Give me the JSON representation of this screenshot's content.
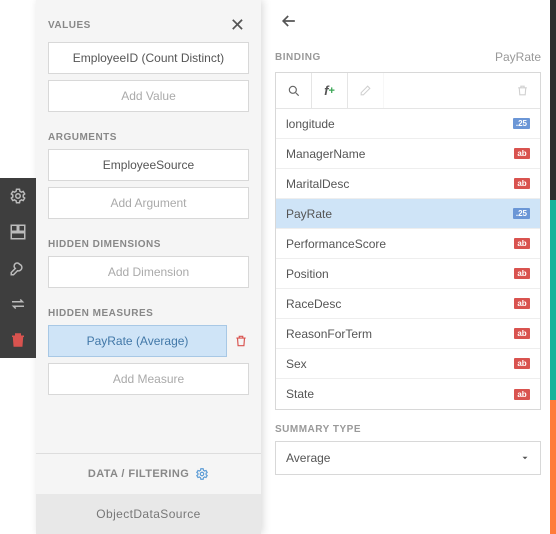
{
  "toolbar": {
    "icons": [
      "gear-icon",
      "layout-icon",
      "wrench-icon",
      "swap-icon",
      "trash-icon"
    ]
  },
  "left": {
    "values_label": "VALUES",
    "values_item": "EmployeeID (Count Distinct)",
    "add_value": "Add Value",
    "arguments_label": "ARGUMENTS",
    "arguments_item": "EmployeeSource",
    "add_argument": "Add Argument",
    "hidden_dim_label": "HIDDEN DIMENSIONS",
    "add_dimension": "Add Dimension",
    "hidden_meas_label": "HIDDEN MEASURES",
    "hidden_meas_item": "PayRate (Average)",
    "add_measure": "Add Measure",
    "data_filtering": "DATA / FILTERING",
    "data_source": "ObjectDataSource"
  },
  "right": {
    "binding_label": "BINDING",
    "binding_value": "PayRate",
    "fields": [
      {
        "name": "longitude",
        "type": "num"
      },
      {
        "name": "ManagerName",
        "type": "txt"
      },
      {
        "name": "MaritalDesc",
        "type": "txt"
      },
      {
        "name": "PayRate",
        "type": "num",
        "selected": true
      },
      {
        "name": "PerformanceScore",
        "type": "txt"
      },
      {
        "name": "Position",
        "type": "txt"
      },
      {
        "name": "RaceDesc",
        "type": "txt"
      },
      {
        "name": "ReasonForTerm",
        "type": "txt"
      },
      {
        "name": "Sex",
        "type": "txt"
      },
      {
        "name": "State",
        "type": "txt"
      }
    ],
    "badge_num": ".25",
    "badge_txt": "ab",
    "summary_label": "SUMMARY TYPE",
    "summary_value": "Average"
  },
  "colors": {
    "edge": [
      "#2f2f2f",
      "#18b39b",
      "#ff7b3a"
    ]
  }
}
